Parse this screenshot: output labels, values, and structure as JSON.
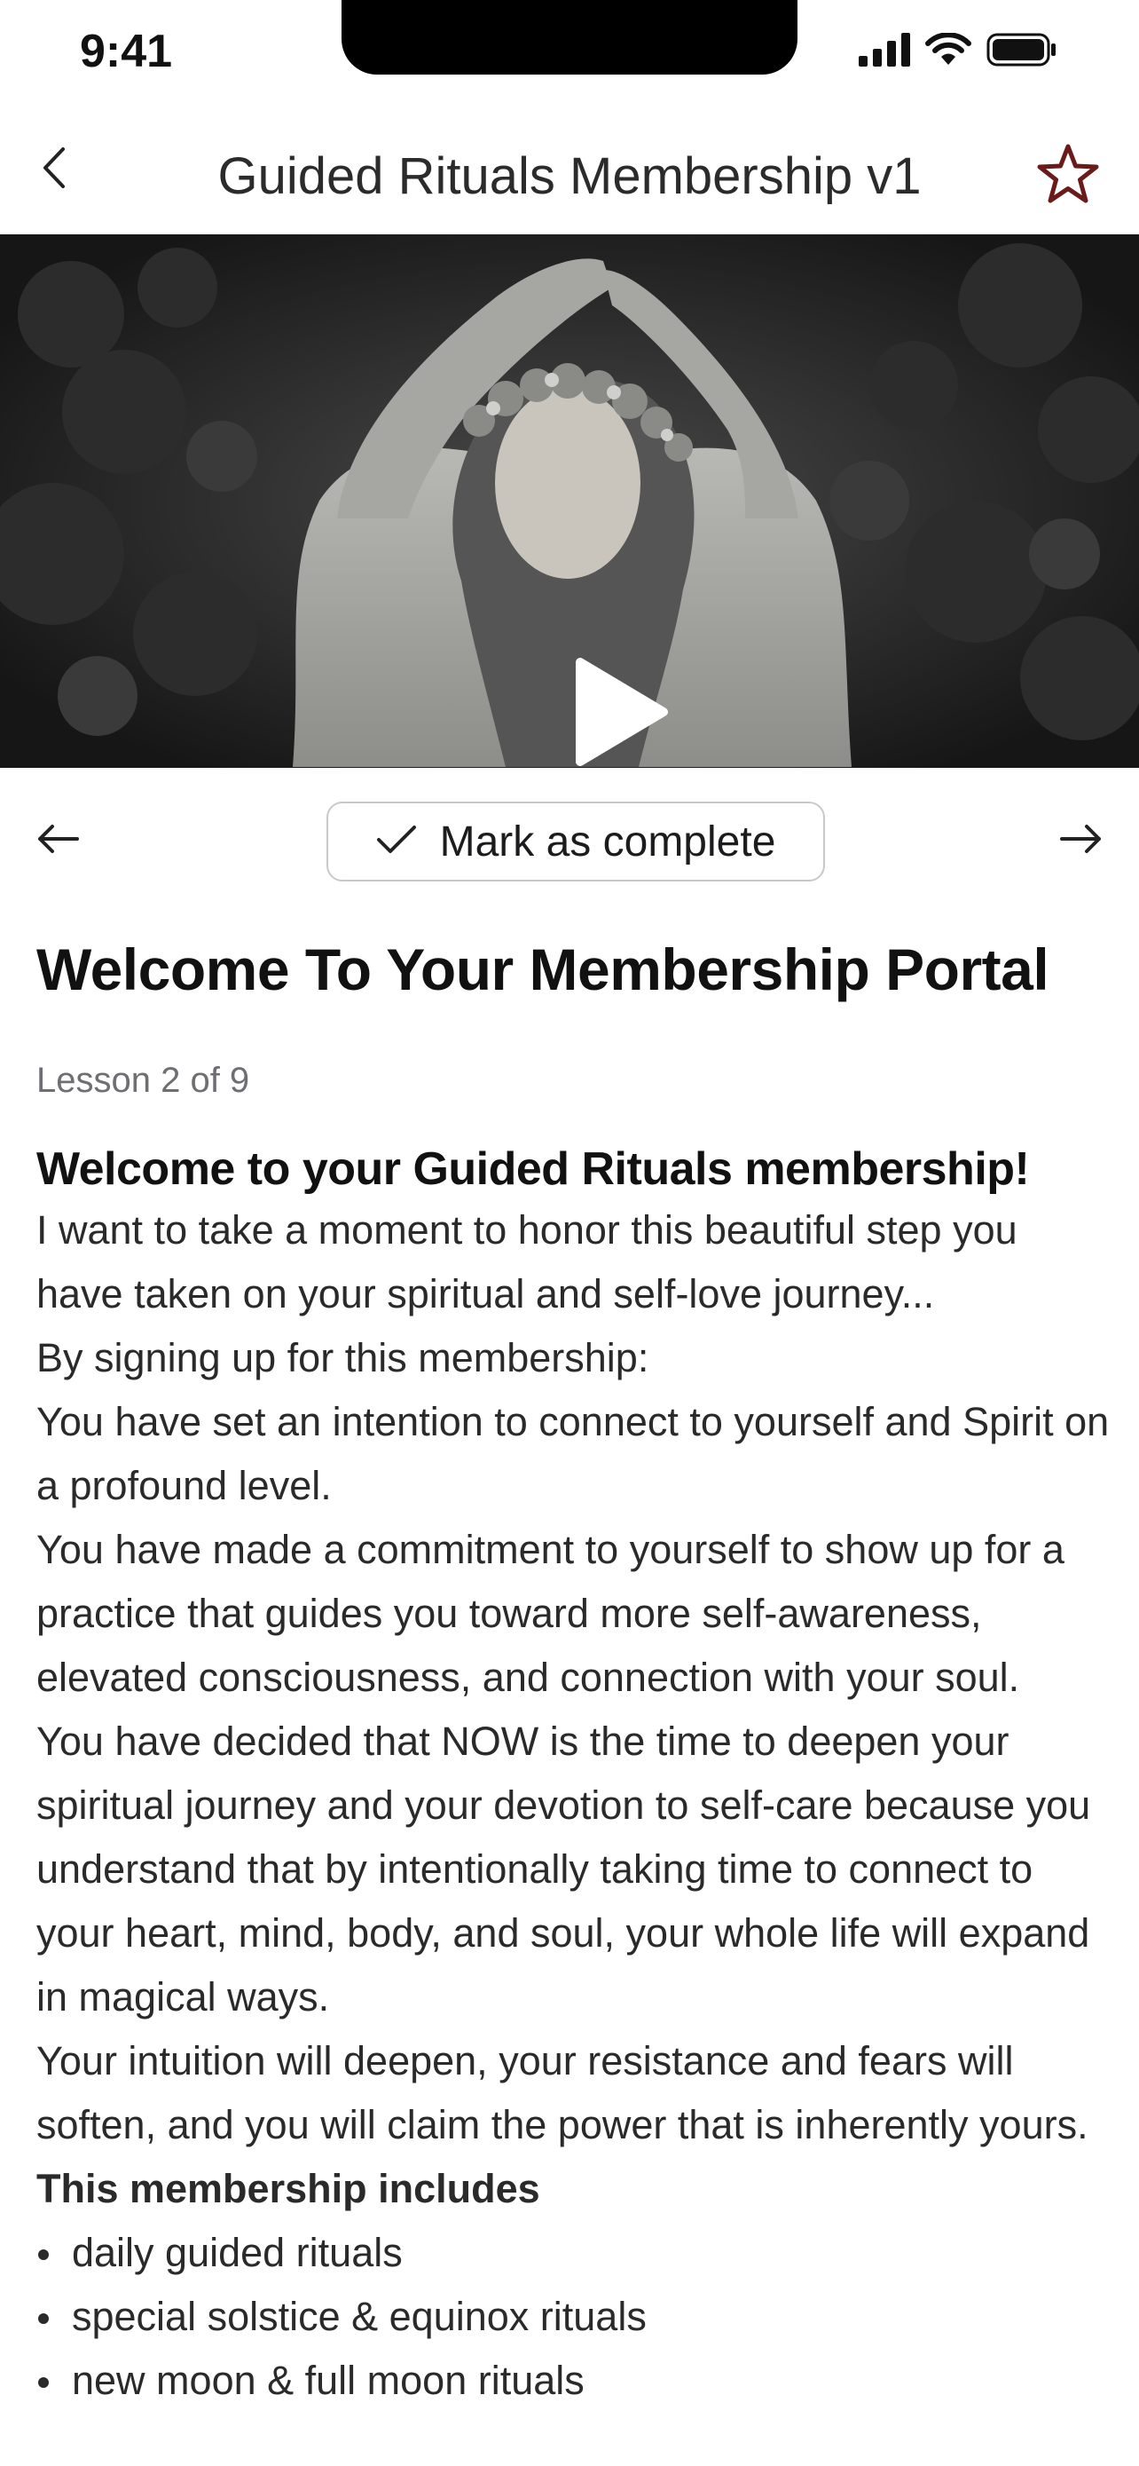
{
  "status_bar": {
    "time": "9:41"
  },
  "nav": {
    "title": "Guided Rituals Membership v1"
  },
  "video": {
    "thumbnail_icon": "play-icon"
  },
  "lesson_nav": {
    "complete_label": "Mark as complete"
  },
  "lesson": {
    "title": "Welcome To Your Membership Portal",
    "count": "Lesson 2 of 9",
    "intro_heading": "Welcome to your Guided Rituals membership!",
    "paragraphs": [
      "I want to take a moment to honor this beautiful step you have taken on your spiritual and self-love journey...",
      "By signing up for this membership:",
      "You have set an intention to connect to yourself and Spirit on a profound level.",
      "You have made a commitment to yourself to show up for a practice that guides you toward more self-awareness, elevated consciousness, and connection with your soul.",
      "You have decided that NOW is the time to deepen your spiritual journey and your devotion to self-care because you understand that by intentionally taking time to connect to your heart, mind, body, and soul, your whole life will expand in magical ways.",
      "Your intuition will deepen, your resistance and fears will soften, and you will claim the power that is inherently yours."
    ],
    "includes_heading": "This membership includes",
    "includes": [
      "daily guided rituals",
      "special solstice & equinox rituals",
      "new moon & full moon rituals"
    ]
  },
  "colors": {
    "star": "#6b1a1a",
    "button_border": "#c9c9c9",
    "muted_text": "#6e6e73"
  }
}
